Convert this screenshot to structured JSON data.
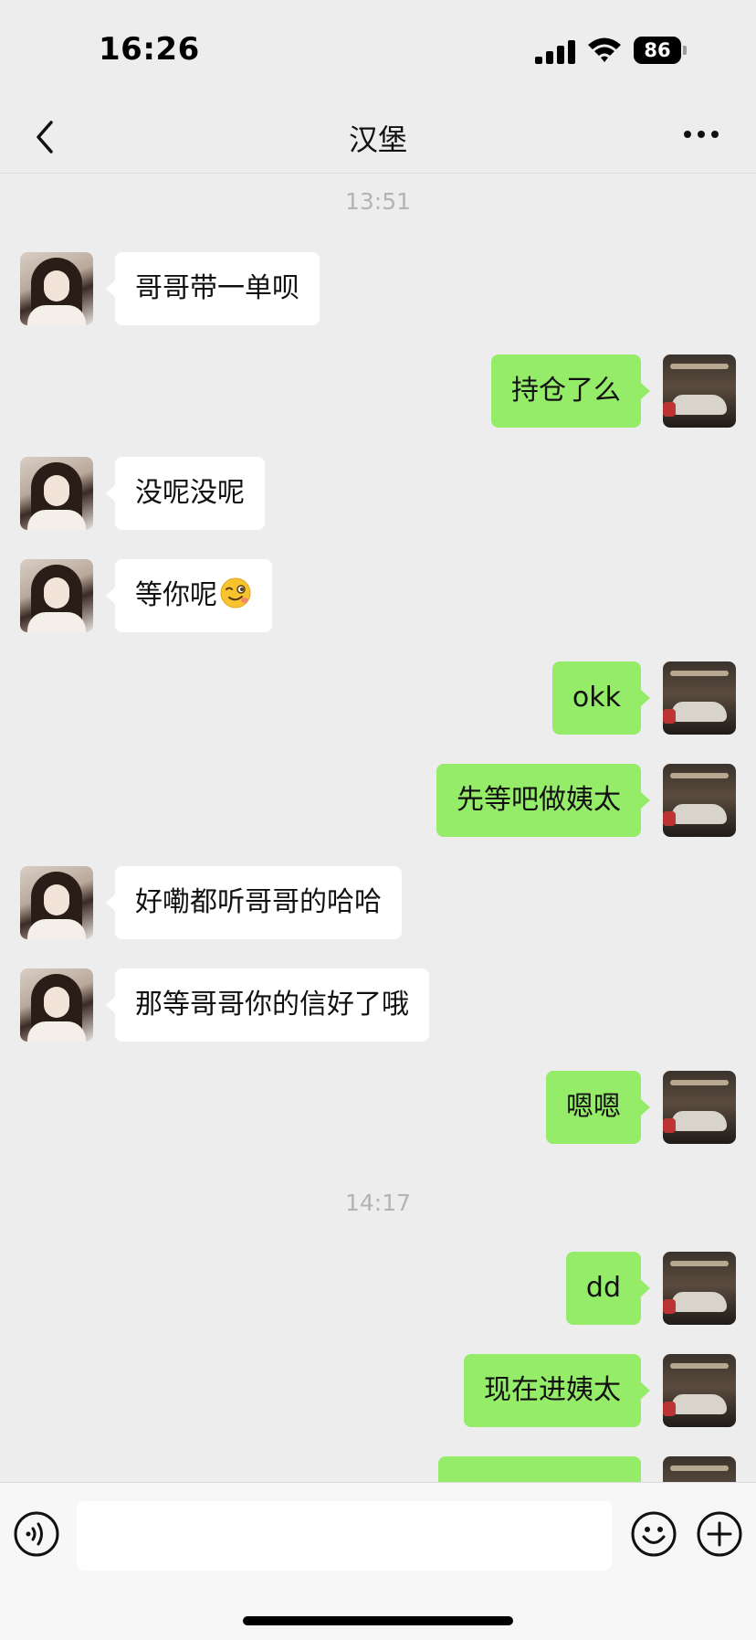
{
  "status_bar": {
    "time": "16:26",
    "battery": "86",
    "icons": [
      "signal-icon",
      "wifi-icon",
      "battery-icon"
    ]
  },
  "nav": {
    "title": "汉堡",
    "icons": [
      "back-icon",
      "more-icon"
    ]
  },
  "timestamps": [
    "13:51",
    "14:17"
  ],
  "messages": [
    {
      "side": "left",
      "text": "哥哥带一单呗"
    },
    {
      "side": "right",
      "text": "持仓了么"
    },
    {
      "side": "left",
      "text": "没呢没呢"
    },
    {
      "side": "left",
      "text": "等你呢",
      "emoji": "wink-emoji"
    },
    {
      "side": "right",
      "text": "okk"
    },
    {
      "side": "right",
      "text": "先等吧做姨太"
    },
    {
      "side": "left",
      "text": "好嘞都听哥哥的哈哈"
    },
    {
      "side": "left",
      "text": "那等哥哥你的信好了哦"
    },
    {
      "side": "right",
      "text": "嗯嗯"
    },
    {
      "side": "right",
      "text": "dd"
    },
    {
      "side": "right",
      "text": "现在进姨太"
    },
    {
      "side": "right",
      "text": ""
    }
  ],
  "input_bar": {
    "placeholder": "",
    "icons": [
      "voice-icon",
      "emoji-icon",
      "plus-icon"
    ]
  },
  "colors": {
    "background": "#ededed",
    "sent_bubble": "#95ec69",
    "received_bubble": "#ffffff"
  }
}
